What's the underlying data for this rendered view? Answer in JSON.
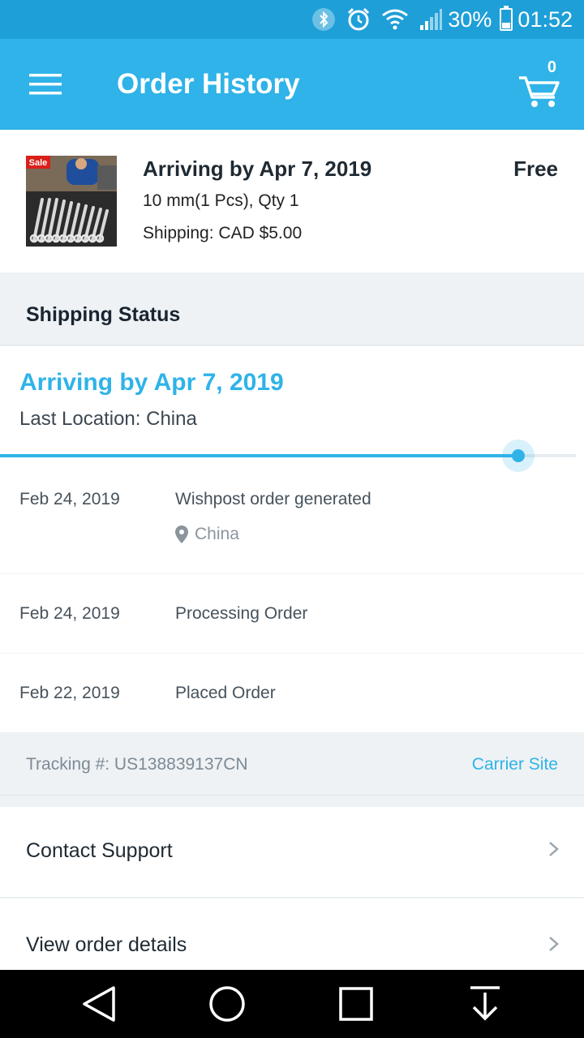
{
  "status_bar": {
    "battery_percent_text": "30%",
    "battery_level": 0.3,
    "time": "01:52",
    "icons": [
      "bluetooth-icon",
      "alarm-icon",
      "wifi-icon",
      "signal-icon",
      "battery-icon"
    ]
  },
  "app_bar": {
    "title": "Order History",
    "cart_count": "0",
    "icons": [
      "menu-icon",
      "cart-icon"
    ]
  },
  "order": {
    "image_badge": "Sale",
    "title": "Arriving by Apr 7, 2019",
    "price": "Free",
    "variant": "10 mm(1 Pcs), Qty 1",
    "shipping": "Shipping: CAD $5.00"
  },
  "shipping_status": {
    "header": "Shipping Status",
    "arriving": "Arriving by Apr 7, 2019",
    "last_location": "Last Location: China",
    "progress": 0.9,
    "events": [
      {
        "date": "Feb 24, 2019",
        "description": "Wishpost order generated",
        "location": "China"
      },
      {
        "date": "Feb 24, 2019",
        "description": "Processing Order"
      },
      {
        "date": "Feb 22, 2019",
        "description": "Placed Order"
      }
    ],
    "tracking_number": "Tracking #: US138839137CN",
    "carrier_site": "Carrier Site"
  },
  "actions": [
    {
      "label": "Contact Support"
    },
    {
      "label": "View order details"
    }
  ],
  "nav_bar": {
    "icons": [
      "back-icon",
      "home-icon",
      "recents-icon",
      "download-icon"
    ]
  },
  "colors": {
    "status_bar": "#1e9fd8",
    "app_bar": "#2fb3e8",
    "accent": "#2fb3e8",
    "background": "#eef2f5"
  }
}
